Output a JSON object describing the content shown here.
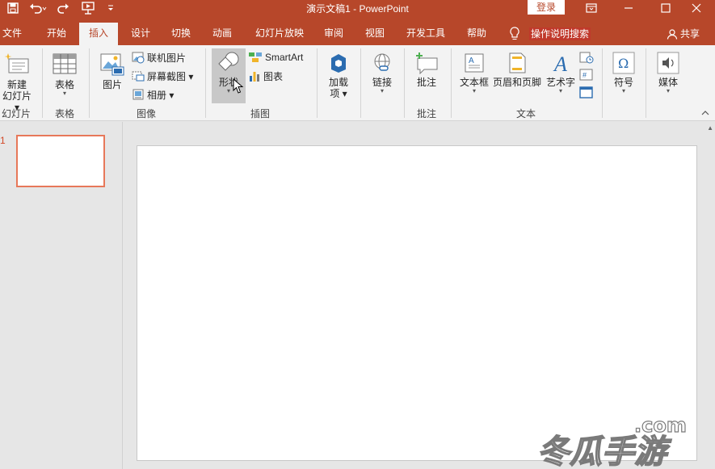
{
  "app": {
    "window_title": "演示文稿1 - PowerPoint",
    "login_label": "登录"
  },
  "tabs": [
    {
      "label": "文件"
    },
    {
      "label": "开始"
    },
    {
      "label": "插入",
      "active": true
    },
    {
      "label": "设计"
    },
    {
      "label": "切换"
    },
    {
      "label": "动画"
    },
    {
      "label": "幻灯片放映"
    },
    {
      "label": "审阅"
    },
    {
      "label": "视图"
    },
    {
      "label": "开发工具"
    },
    {
      "label": "帮助"
    }
  ],
  "tell_me": "操作说明搜索",
  "share": "共享",
  "ribbon": {
    "slides": {
      "new_slide_line1": "新建",
      "new_slide_line2": "幻灯片",
      "group": "幻灯片"
    },
    "tables": {
      "table": "表格",
      "group": "表格"
    },
    "images": {
      "picture": "图片",
      "online_pictures": "联机图片",
      "screenshot": "屏幕截图",
      "album": "相册",
      "group": "图像"
    },
    "illustrations": {
      "shapes": "形状",
      "smartart": "SmartArt",
      "chart": "图表",
      "group": "插图"
    },
    "addins": {
      "line1": "加载",
      "line2": "项"
    },
    "links": {
      "link": "链接"
    },
    "comments": {
      "comment": "批注",
      "group": "批注"
    },
    "text": {
      "textbox": "文本框",
      "header_footer": "页眉和页脚",
      "wordart": "艺术字",
      "group": "文本"
    },
    "symbols": {
      "symbol": "符号"
    },
    "media": {
      "media": "媒体"
    }
  },
  "slides_pane": {
    "slide_number": "1"
  },
  "watermark": {
    "text_top": ".com",
    "text_main": "冬瓜手游"
  },
  "colors": {
    "brand": "#b7472a",
    "accent_thumb": "#e7785a",
    "tab_active_bg": "#f3f3f3"
  }
}
